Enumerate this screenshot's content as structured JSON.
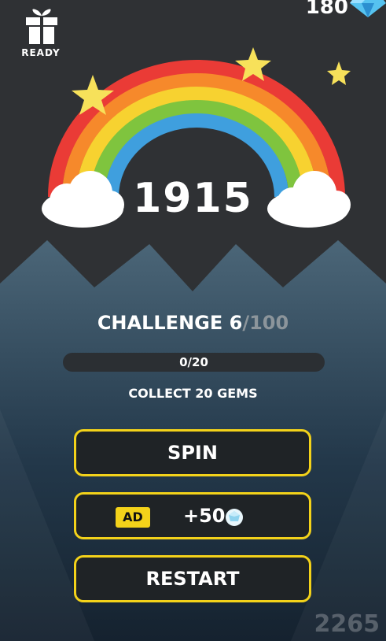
{
  "header": {
    "gift_status": "READY",
    "gems": "180",
    "gift_icon": "gift-icon",
    "gem_icon": "diamond-icon"
  },
  "score": "1915",
  "challenge": {
    "label": "CHALLENGE 6",
    "total": "/100"
  },
  "progress": {
    "text": "0/20",
    "fraction": 0
  },
  "goal": "COLLECT 20 GEMS",
  "buttons": {
    "spin": "SPIN",
    "ad_badge": "AD",
    "ad_reward": "+50",
    "restart": "RESTART"
  },
  "watermark": "2265",
  "colors": {
    "accent": "#f3d21a",
    "background": "#2f3134",
    "button_bg": "#1f2326"
  }
}
